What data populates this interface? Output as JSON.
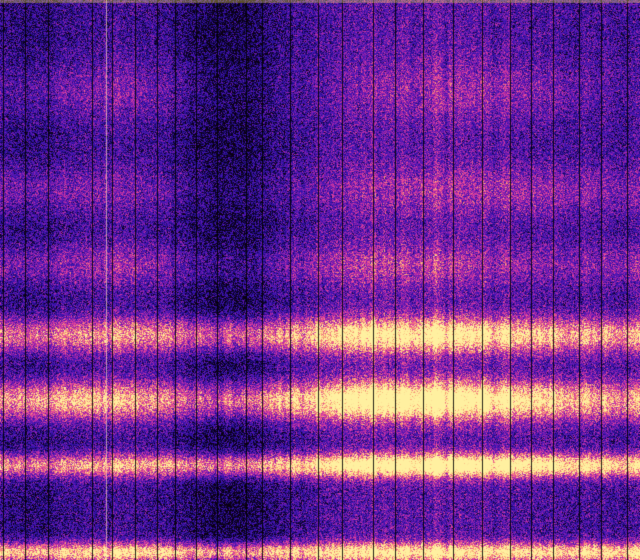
{
  "image": {
    "kind": "spectrogram",
    "colormap": "plasma",
    "palette": [
      "#0a0010",
      "#1a0a6a",
      "#3a14b4",
      "#6a1ab0",
      "#b02aa8",
      "#e84898",
      "#f8a070",
      "#fff0a0"
    ],
    "background": "#0a0010",
    "band_color": "#f6e25a",
    "gridline_color": "#000000"
  }
}
